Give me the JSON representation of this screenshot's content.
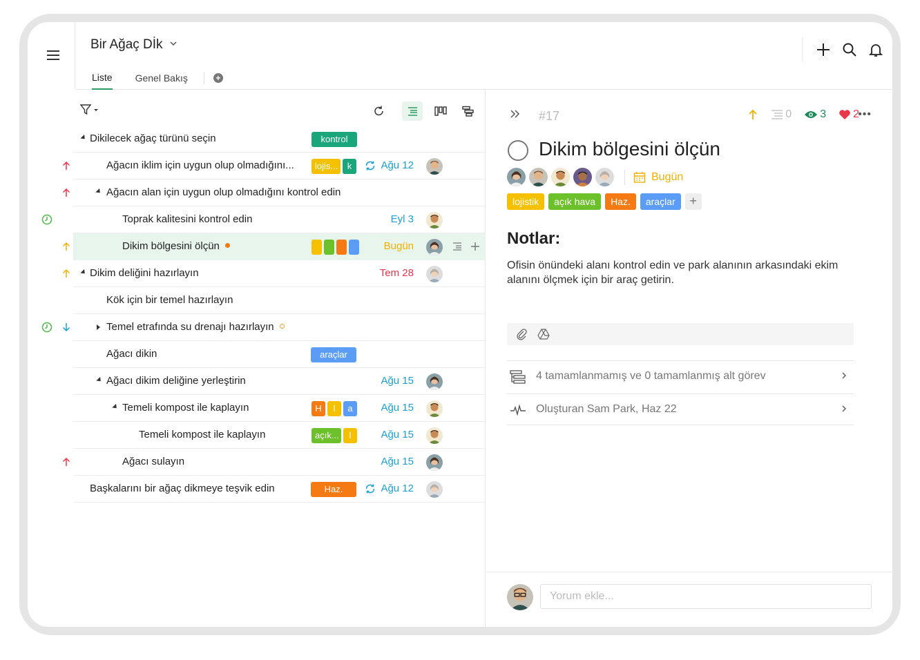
{
  "project": {
    "title": "Bir Ağaç Dİk"
  },
  "tabs": [
    {
      "label": "Liste"
    },
    {
      "label": "Genel Bakış"
    }
  ],
  "rows": [
    {
      "title": "Dikilecek ağaç türünü seçin",
      "tags": [
        {
          "label": "kontrol",
          "color": "#1aa57a"
        }
      ],
      "date": ""
    },
    {
      "title": "Ağacın iklim için uygun olup olmadığını...",
      "tags": [
        {
          "label": "lojis...",
          "color": "#f5c000"
        },
        {
          "label": "k",
          "color": "#1aa57a"
        }
      ],
      "date": "Ağu 12",
      "priority": "high",
      "repeat": true
    },
    {
      "title": "Ağacın alan için uygun olup olmadığını kontrol edin",
      "tags": [],
      "date": "",
      "priority": "high"
    },
    {
      "title": "Toprak kalitesini kontrol edin",
      "tags": [],
      "date": "Eyl 3"
    },
    {
      "title": "Dikim bölgesini ölçün",
      "tags": [
        {
          "label": "",
          "color": "#f5c000"
        },
        {
          "label": "",
          "color": "#6cc02a"
        },
        {
          "label": "",
          "color": "#f57a14"
        },
        {
          "label": "",
          "color": "#5b9cf6"
        }
      ],
      "date": "Bugün",
      "priority": "normal"
    },
    {
      "title": "Dikim deliğini hazırlayın",
      "tags": [],
      "date": "Tem 28",
      "priority": "normal"
    },
    {
      "title": "Kök için bir temel hazırlayın",
      "tags": [],
      "date": ""
    },
    {
      "title": "Temel etrafında su drenajı hazırlayın",
      "tags": [],
      "date": "",
      "priority": "low"
    },
    {
      "title": "Ağacı dikin",
      "tags": [
        {
          "label": "araçlar",
          "color": "#5b9cf6"
        }
      ],
      "date": ""
    },
    {
      "title": "Ağacı dikim deliğine yerleştirin",
      "tags": [],
      "date": "Ağu 15"
    },
    {
      "title": "Temeli kompost ile kaplayın",
      "tags": [
        {
          "label": "H",
          "color": "#f57a14"
        },
        {
          "label": "l",
          "color": "#f5c000"
        },
        {
          "label": "a",
          "color": "#5b9cf6"
        }
      ],
      "date": "Ağu 15"
    },
    {
      "title": "Temeli kompost ile kaplayın",
      "tags": [
        {
          "label": "açık...",
          "color": "#6cc02a"
        },
        {
          "label": "l",
          "color": "#f5c000"
        }
      ],
      "date": "Ağu 15"
    },
    {
      "title": "Ağacı sulayın",
      "tags": [],
      "date": "Ağu 15",
      "priority": "high"
    },
    {
      "title": "Başkalarını bir ağaç dikmeye teşvik edin",
      "tags": [
        {
          "label": "Haz.",
          "color": "#f57a14"
        }
      ],
      "date": "Ağu 12",
      "repeat": true
    }
  ],
  "detail": {
    "id": "#17",
    "subtasks_count": "0",
    "watchers": "3",
    "likes": "2",
    "title": "Dikim bölgesini ölçün",
    "due": "Bugün",
    "tags": [
      {
        "label": "lojistik",
        "color": "#f5c000"
      },
      {
        "label": "açık hava",
        "color": "#6cc02a"
      },
      {
        "label": "Haz.",
        "color": "#f57a14"
      },
      {
        "label": "araçlar",
        "color": "#5b9cf6"
      }
    ],
    "notes_title": "Notlar:",
    "notes": "Ofisin önündeki alanı kontrol edin ve park alanının arkasındaki ekim alanını ölçmek için bir araç getirin.",
    "subtasks_link": "4 tamamlanmamış ve 0 tamamlanmış alt görev",
    "created_link": "Oluşturan Sam Park, Haz 22",
    "comment_placeholder": "Yorum ekle..."
  },
  "colors": {
    "accent": "#2d9c62",
    "date_blue": "#1aa0d8",
    "date_orange": "#f0b000",
    "date_red": "#e8364a",
    "priority_red": "#e8364a",
    "priority_yellow": "#f0b000",
    "watch_green": "#1a8a5a",
    "like_red": "#e8364a"
  }
}
